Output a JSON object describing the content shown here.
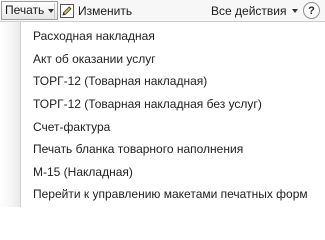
{
  "toolbar": {
    "print_label": "Печать",
    "edit_label": "Изменить",
    "all_actions_label": "Все действия",
    "help_label": "?"
  },
  "menu": {
    "items": [
      {
        "label": "Расходная накладная"
      },
      {
        "label": "Акт об оказании услуг"
      },
      {
        "label": "ТОРГ-12 (Товарная накладная)"
      },
      {
        "label": "ТОРГ-12 (Товарная накладная без услуг)"
      },
      {
        "label": "Счет-фактура"
      },
      {
        "label": "Печать бланка товарного наполнения"
      },
      {
        "label": "М-15 (Накладная)"
      },
      {
        "label": "Перейти к управлению макетами печатных форм"
      }
    ]
  }
}
